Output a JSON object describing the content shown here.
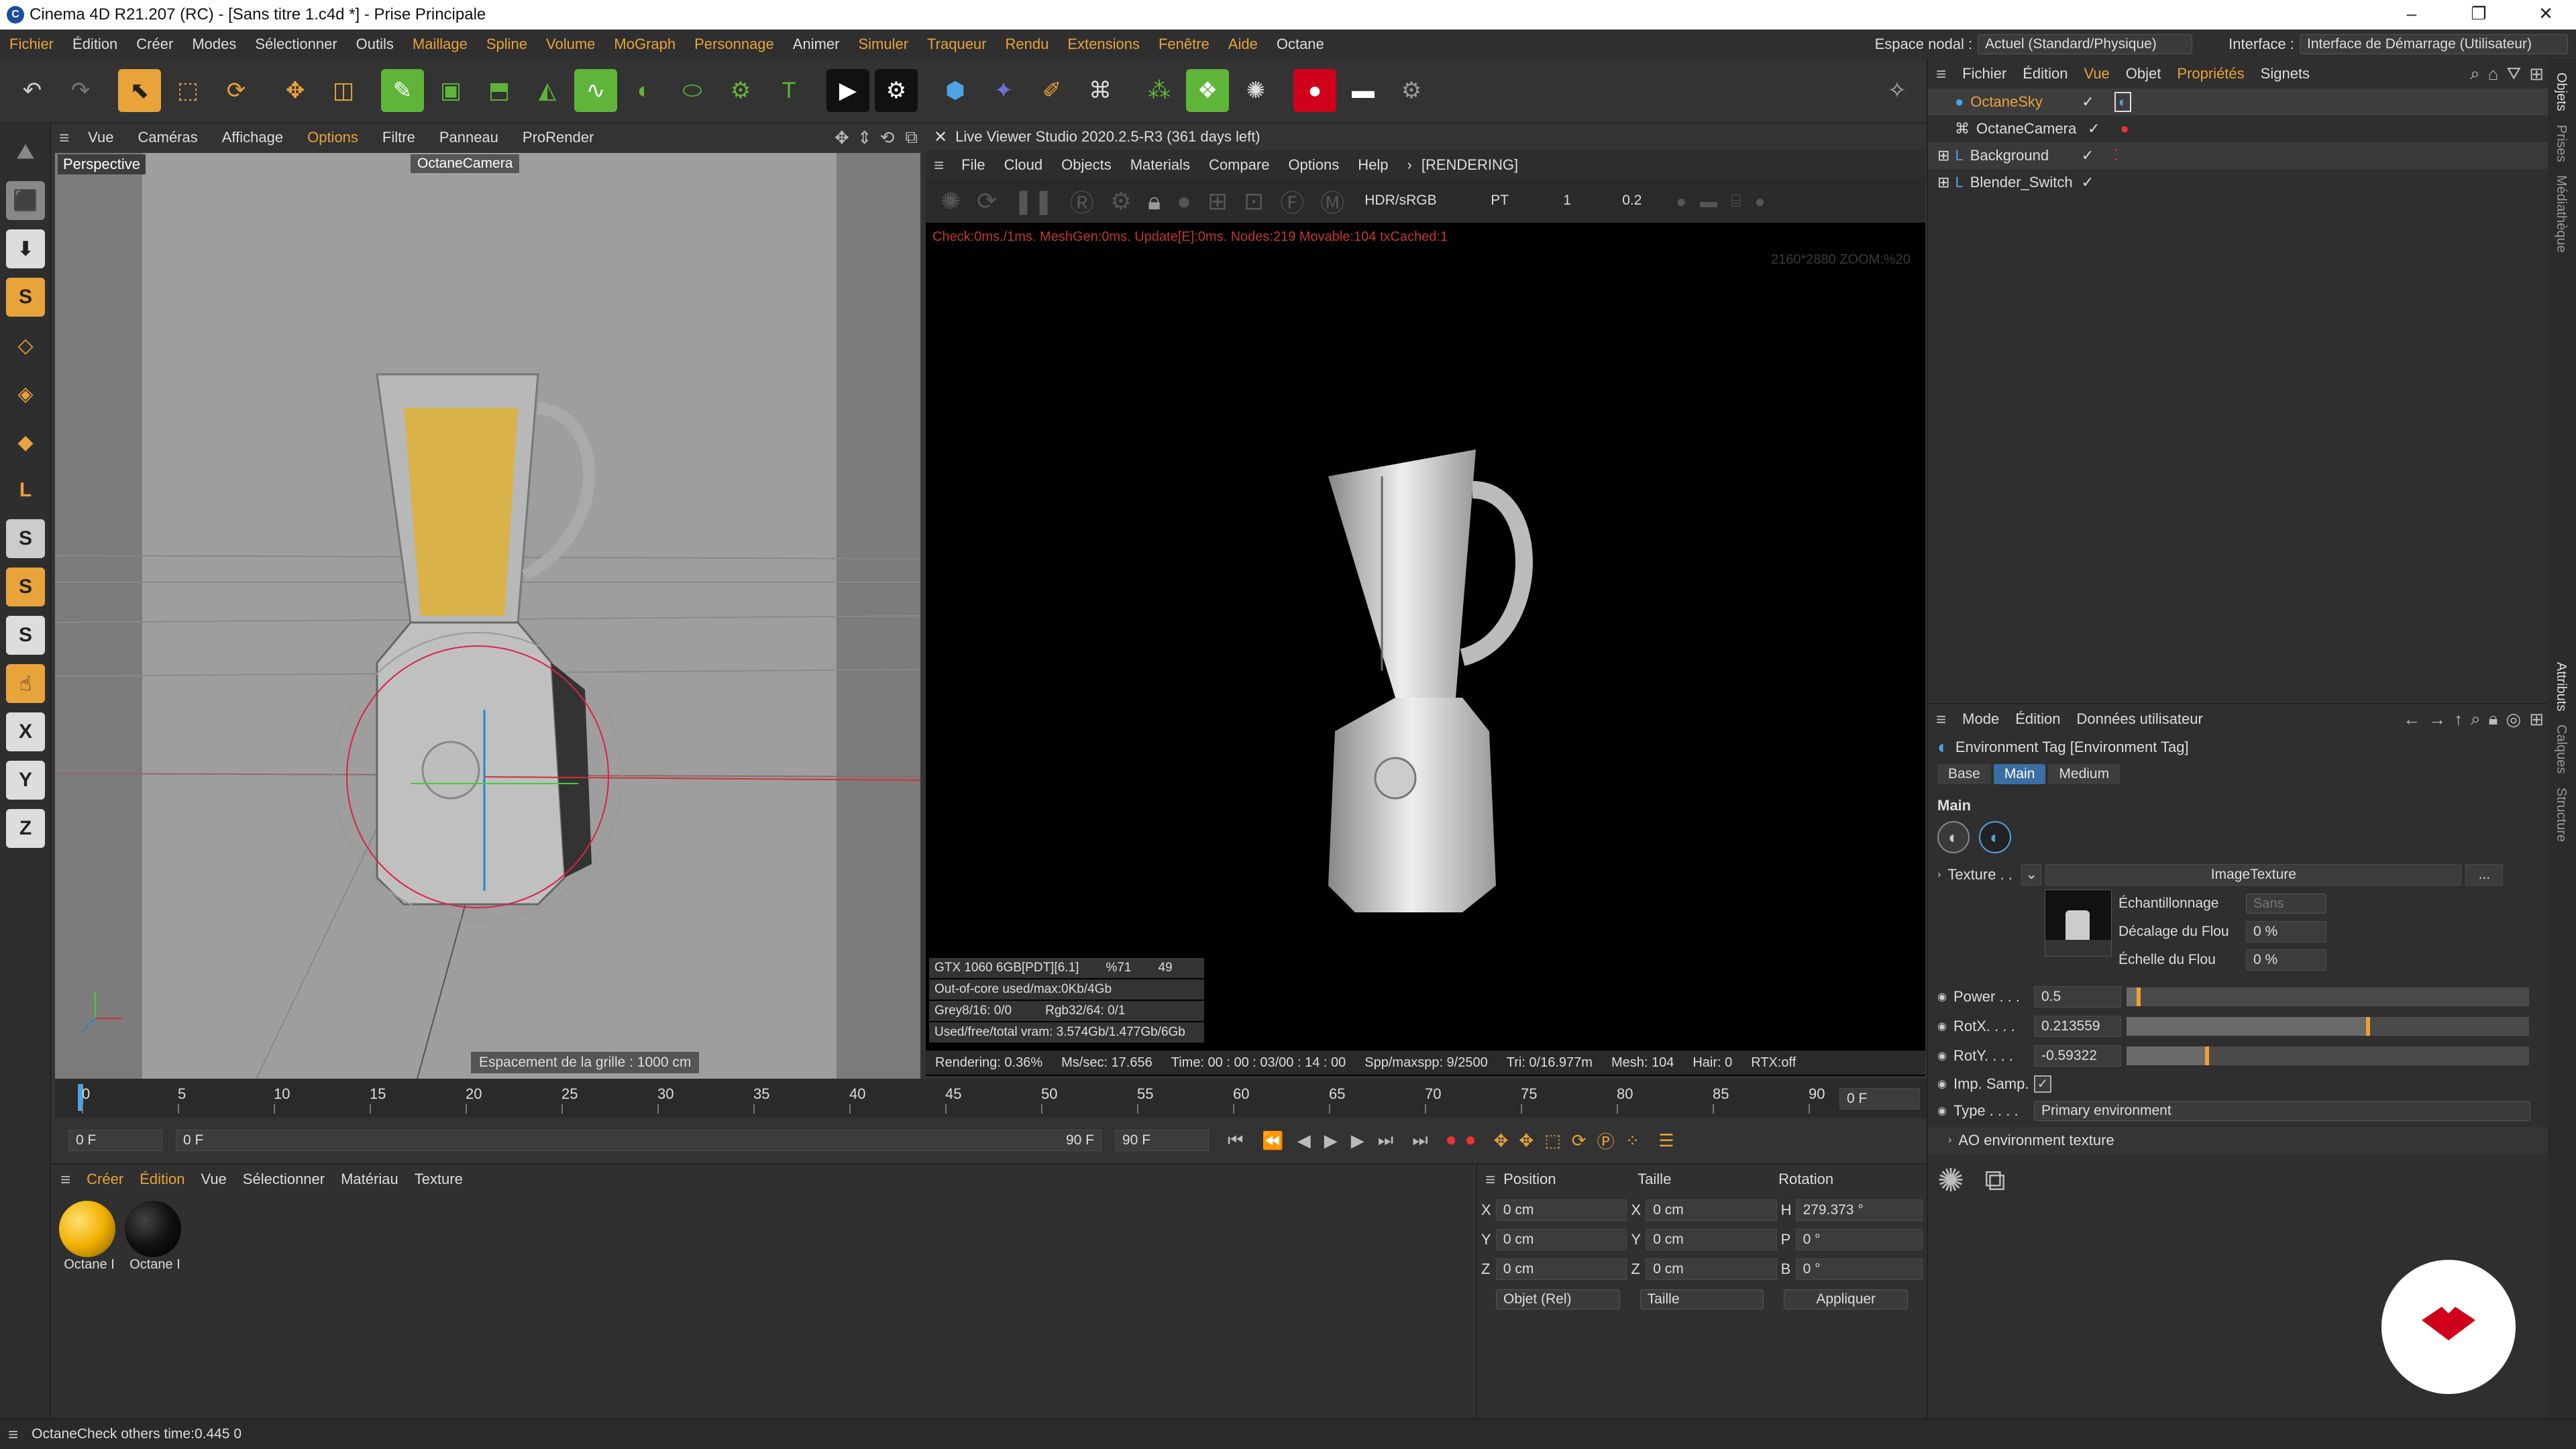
{
  "window": {
    "title": "Cinema 4D R21.207 (RC) - [Sans titre 1.c4d *] - Prise Principale",
    "minimize": "–",
    "maximize": "❐",
    "close": "✕"
  },
  "menu": {
    "items": [
      "Fichier",
      "Édition",
      "Créer",
      "Modes",
      "Sélectionner",
      "Outils",
      "Maillage",
      "Spline",
      "Volume",
      "MoGraph",
      "Personnage",
      "Animer",
      "Simuler",
      "Traqueur",
      "Rendu",
      "Extensions",
      "Fenêtre",
      "Aide",
      "Octane"
    ],
    "espace_label": "Espace nodal :",
    "espace_value": "Actuel (Standard/Physique)",
    "interface_label": "Interface :",
    "interface_value": "Interface de Démarrage (Utilisateur)"
  },
  "viewport": {
    "menu": [
      "Vue",
      "Caméras",
      "Affichage",
      "Options",
      "Filtre",
      "Panneau",
      "ProRender"
    ],
    "label": "Perspective",
    "camera": "OctaneCamera",
    "grid": "Espacement de la grille : 1000 cm"
  },
  "live_viewer": {
    "title": "Live Viewer Studio 2020.2.5-R3 (361 days left)",
    "menu": [
      "File",
      "Cloud",
      "Objects",
      "Materials",
      "Compare",
      "Options",
      "Help"
    ],
    "state": "[RENDERING]",
    "mode": "HDR/sRGB",
    "kernel": "PT",
    "v1": "1",
    "v2": "0.2",
    "check": "Check:0ms./1ms. MeshGen:0ms. Update[E]:0ms. Nodes:219 Movable:104 txCached:1",
    "zoom": "2160*2880 ZOOM:%20",
    "gpu": "GTX 1060 6GB[PDT][6.1]",
    "gpu_pct": "%71",
    "gpu_temp": "49",
    "outofcore": "Out-of-core used/max:0Kb/4Gb",
    "grey": "Grey8/16: 0/0",
    "rgb": "Rgb32/64: 0/1",
    "vram": "Used/free/total vram: 3.574Gb/1.477Gb/6Gb",
    "status": [
      "Rendering: 0.36%",
      "Ms/sec: 17.656",
      "Time: 00 : 00 : 03/00 : 14 : 00",
      "Spp/maxspp: 9/2500",
      "Tri: 0/16.977m",
      "Mesh: 104",
      "Hair: 0",
      "RTX:off"
    ]
  },
  "timeline": {
    "ticks": [
      "0",
      "5",
      "10",
      "15",
      "20",
      "25",
      "30",
      "35",
      "40",
      "45",
      "50",
      "55",
      "60",
      "65",
      "70",
      "75",
      "80",
      "85",
      "90"
    ],
    "frame": "0 F",
    "start": "0 F",
    "start2": "0 F",
    "end": "90 F",
    "end2": "90 F"
  },
  "materials": {
    "menu": [
      "Créer",
      "Édition",
      "Vue",
      "Sélectionner",
      "Matériau",
      "Texture"
    ],
    "items": [
      {
        "name": "Octane I",
        "color": "#f0b000"
      },
      {
        "name": "Octane I",
        "color": "#111111"
      }
    ]
  },
  "coords": {
    "headers": [
      "Position",
      "Taille",
      "Rotation"
    ],
    "rows": [
      {
        "a": "X",
        "pos": "0 cm",
        "b": "X",
        "size": "0 cm",
        "c": "H",
        "rot": "279.373 °"
      },
      {
        "a": "Y",
        "pos": "0 cm",
        "b": "Y",
        "size": "0 cm",
        "c": "P",
        "rot": "0 °"
      },
      {
        "a": "Z",
        "pos": "0 cm",
        "b": "Z",
        "size": "0 cm",
        "c": "B",
        "rot": "0 °"
      }
    ],
    "mode1": "Objet (Rel)",
    "mode2": "Taille",
    "apply": "Appliquer"
  },
  "objects": {
    "menu": [
      "Fichier",
      "Édition",
      "Vue",
      "Objet",
      "Propriétés",
      "Signets"
    ],
    "items": [
      {
        "name": "OctaneSky"
      },
      {
        "name": "OctaneCamera"
      },
      {
        "name": "Background"
      },
      {
        "name": "Blender_Switch"
      }
    ]
  },
  "attributes": {
    "menu": [
      "Mode",
      "Édition",
      "Données utilisateur"
    ],
    "title": "Environment Tag [Environment Tag]",
    "tabs": [
      "Base",
      "Main",
      "Medium"
    ],
    "section": "Main",
    "texture_label": "Texture . .",
    "texture_value": "ImageTexture",
    "more": "...",
    "sampling_label": "Échantillonnage",
    "sampling_value": "Sans",
    "blur_offset_label": "Décalage du Flou",
    "blur_offset": "0 %",
    "blur_scale_label": "Échelle du Flou",
    "blur_scale": "0 %",
    "power_label": "Power . . .",
    "power": "0.5",
    "rotx_label": "RotX. . . .",
    "rotx": "0.213559",
    "roty_label": "RotY. . . .",
    "roty": "-0.59322",
    "imp_label": "Imp. Samp.",
    "type_label": "Type . . . .",
    "type_value": "Primary environment",
    "ao": "AO environment texture",
    "power_frac": 0.03,
    "rotx_frac": 0.6,
    "roty_frac": 0.2
  },
  "right_strip": [
    "Objets",
    "Prises",
    "Médiathèque",
    "Attributs",
    "Calques",
    "Structure"
  ],
  "status": "OctaneCheck others time:0.445  0",
  "colors": {
    "accent": "#e8a33a",
    "select": "#3a6ea5",
    "green": "#5fb53a"
  }
}
